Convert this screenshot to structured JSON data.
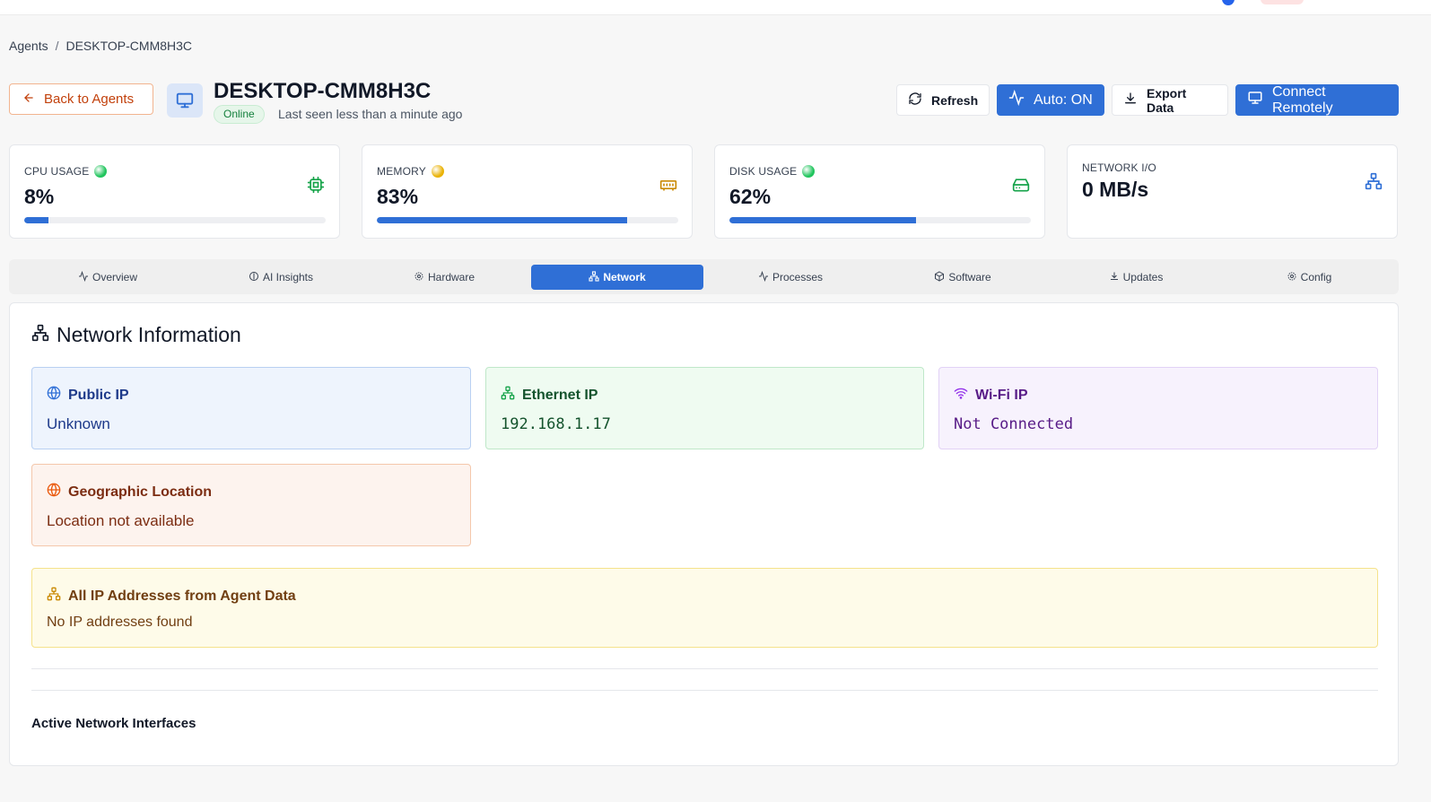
{
  "breadcrumb": {
    "root": "Agents",
    "separator": "/",
    "current": "DESKTOP-CMM8H3C"
  },
  "header": {
    "back_label": "Back to Agents",
    "hostname": "DESKTOP-CMM8H3C",
    "status": "Online",
    "last_seen": "Last seen less than a minute ago",
    "refresh_label": "Refresh",
    "auto_label": "Auto: ON",
    "export_label": "Export Data",
    "connect_label": "Connect Remotely"
  },
  "metrics": {
    "cpu": {
      "label": "CPU USAGE",
      "value": "8%",
      "percent": 8,
      "status_color": "#22c55e",
      "icon": "cpu-icon"
    },
    "memory": {
      "label": "MEMORY",
      "value": "83%",
      "percent": 83,
      "status_color": "#eab308",
      "icon": "memory-icon"
    },
    "disk": {
      "label": "DISK USAGE",
      "value": "62%",
      "percent": 62,
      "status_color": "#22c55e",
      "icon": "hard-drive-icon"
    },
    "network": {
      "label": "NETWORK I/O",
      "value": "0 MB/s",
      "icon": "network-icon"
    }
  },
  "tabs": [
    {
      "label": "Overview",
      "icon": "activity-icon"
    },
    {
      "label": "AI Insights",
      "icon": "lightbulb-icon"
    },
    {
      "label": "Hardware",
      "icon": "gear-icon"
    },
    {
      "label": "Network",
      "icon": "network-icon",
      "active": true
    },
    {
      "label": "Processes",
      "icon": "activity-icon"
    },
    {
      "label": "Software",
      "icon": "package-icon"
    },
    {
      "label": "Updates",
      "icon": "download-icon"
    },
    {
      "label": "Config",
      "icon": "gear-icon"
    }
  ],
  "network": {
    "title": "Network Information",
    "public_ip": {
      "title": "Public IP",
      "value": "Unknown"
    },
    "ethernet_ip": {
      "title": "Ethernet IP",
      "value": "192.168.1.17"
    },
    "wifi_ip": {
      "title": "Wi-Fi IP",
      "value": "Not Connected"
    },
    "geo": {
      "title": "Geographic Location",
      "value": "Location not available"
    },
    "all_ips": {
      "title": "All IP Addresses from Agent Data",
      "value": "No IP addresses found"
    },
    "interfaces_title": "Active Network Interfaces"
  },
  "colors": {
    "accent": "#2f6fd6",
    "success": "#22c55e",
    "warning": "#eab308"
  }
}
